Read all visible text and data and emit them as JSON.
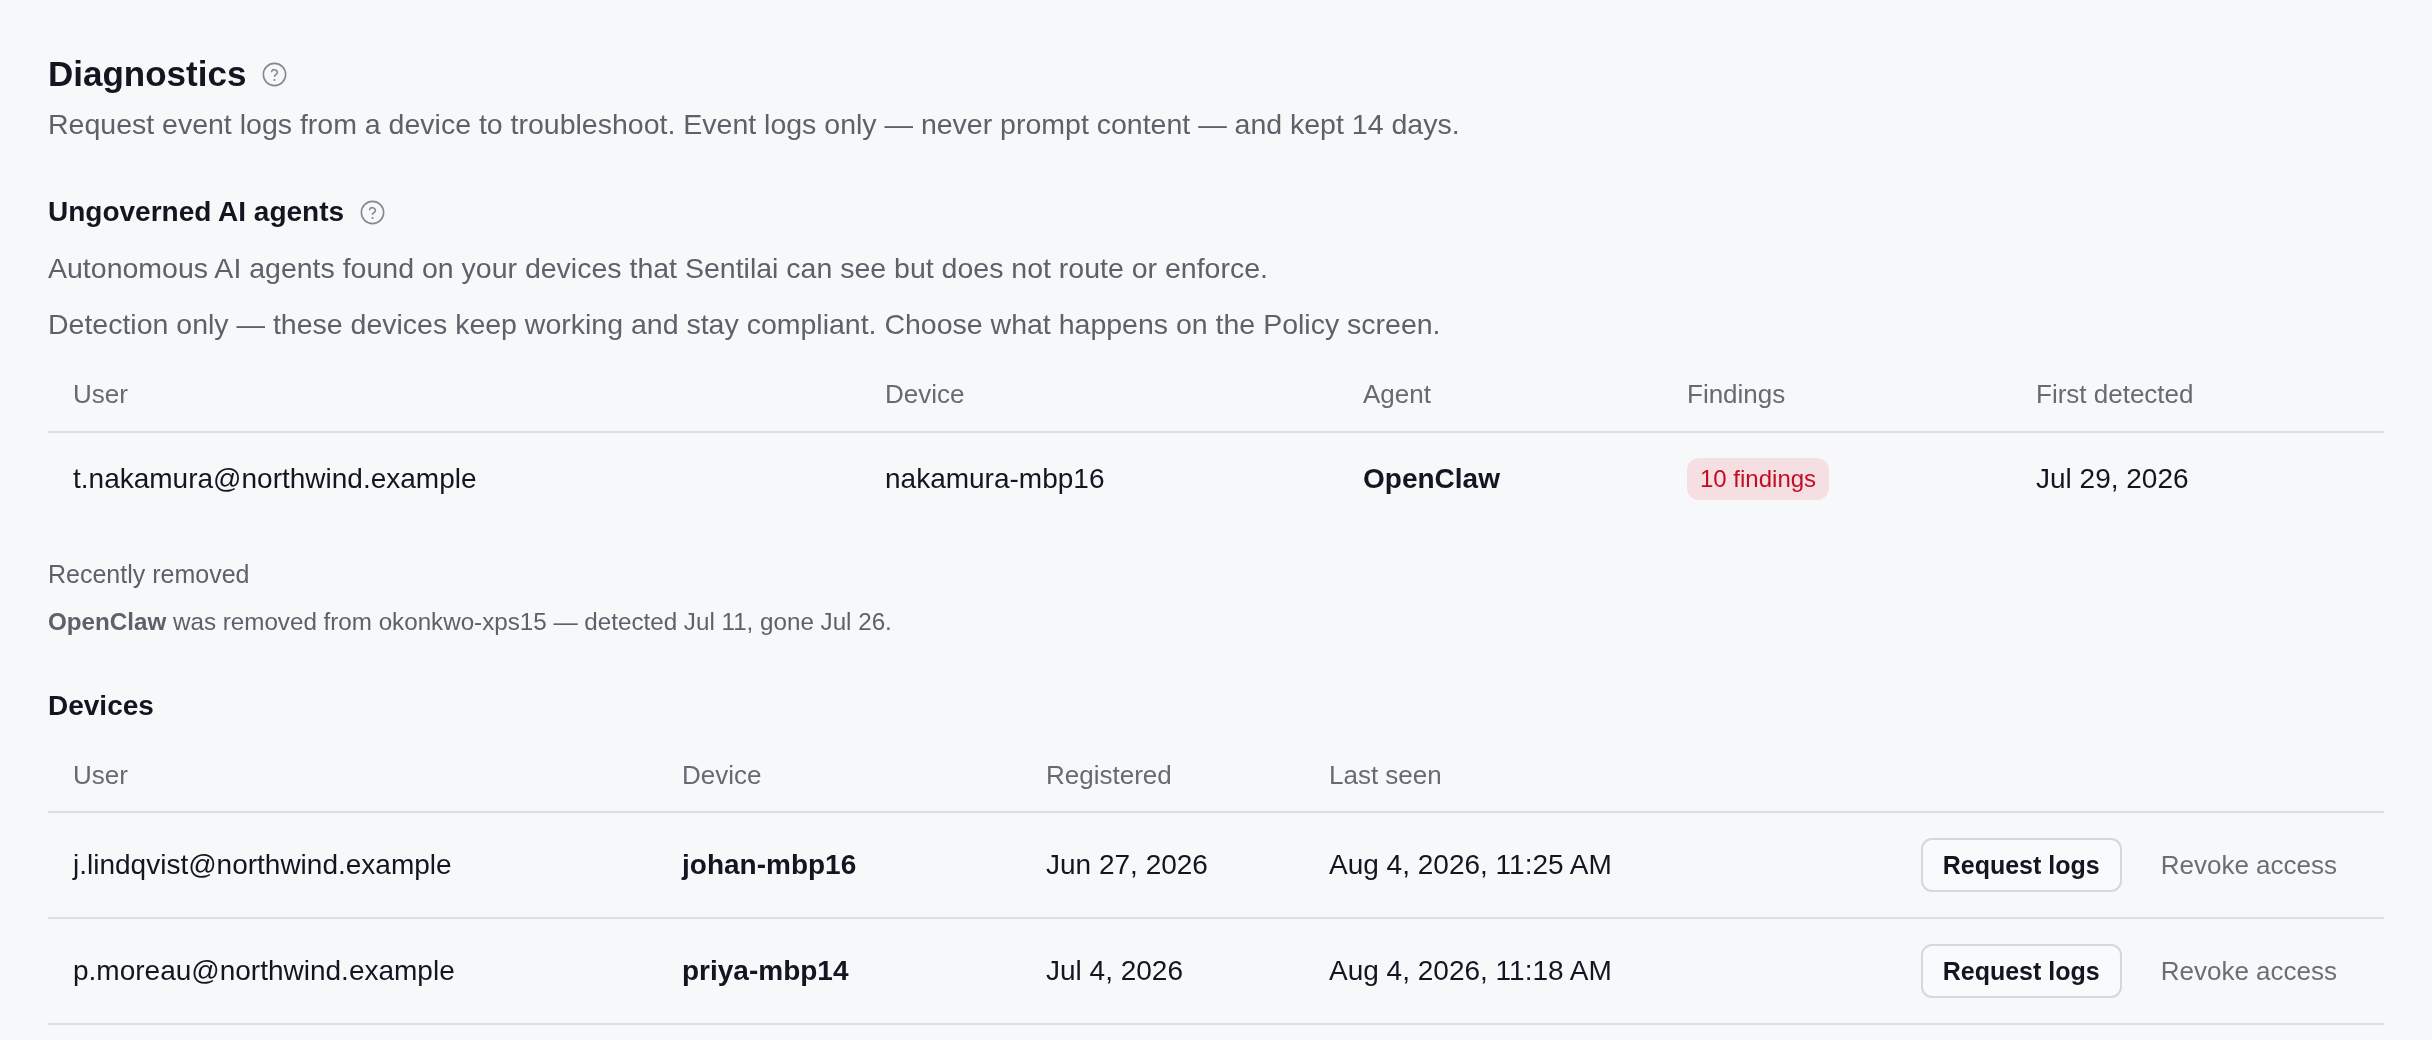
{
  "page": {
    "title": "Diagnostics",
    "description": "Request event logs from a device to troubleshoot. Event logs only — never prompt content — and kept 14 days."
  },
  "agents": {
    "title": "Ungoverned AI agents",
    "descriptions": [
      "Autonomous AI agents found on your devices that Sentilai can see but does not route or enforce.",
      "Detection only — these devices keep working and stay compliant. Choose what happens on the Policy screen."
    ],
    "table": {
      "columns": [
        "User",
        "Device",
        "Agent",
        "Findings",
        "First detected"
      ],
      "rows": [
        {
          "user": "t.nakamura@northwind.example",
          "device": "nakamura-mbp16",
          "agent": "OpenClaw",
          "findings": "10 findings",
          "first_detected": "Jul 29, 2026"
        }
      ]
    }
  },
  "recently_removed": {
    "title": "Recently removed",
    "items": [
      "**OpenClaw** was removed from okonkwo-xps15 — detected Jul 11, gone Jul 26."
    ]
  },
  "devices": {
    "title": "Devices",
    "table": {
      "columns": [
        "User",
        "Device",
        "Registered",
        "Last seen"
      ],
      "rows": [
        {
          "user": "j.lindqvist@northwind.example",
          "device": "johan-mbp16",
          "registered": "Jun 27, 2026",
          "last_seen": "Aug 4, 2026, 11:25 AM",
          "actions": [
            {
              "kind": "button",
              "label": "Request logs"
            },
            {
              "kind": "link",
              "label": "Revoke access"
            }
          ]
        },
        {
          "user": "p.moreau@northwind.example",
          "device": "priya-mbp14",
          "registered": "Jul 4, 2026",
          "last_seen": "Aug 4, 2026, 11:18 AM",
          "actions": [
            {
              "kind": "button",
              "label": "Request logs"
            },
            {
              "kind": "link",
              "label": "Revoke access"
            }
          ]
        }
      ]
    }
  }
}
